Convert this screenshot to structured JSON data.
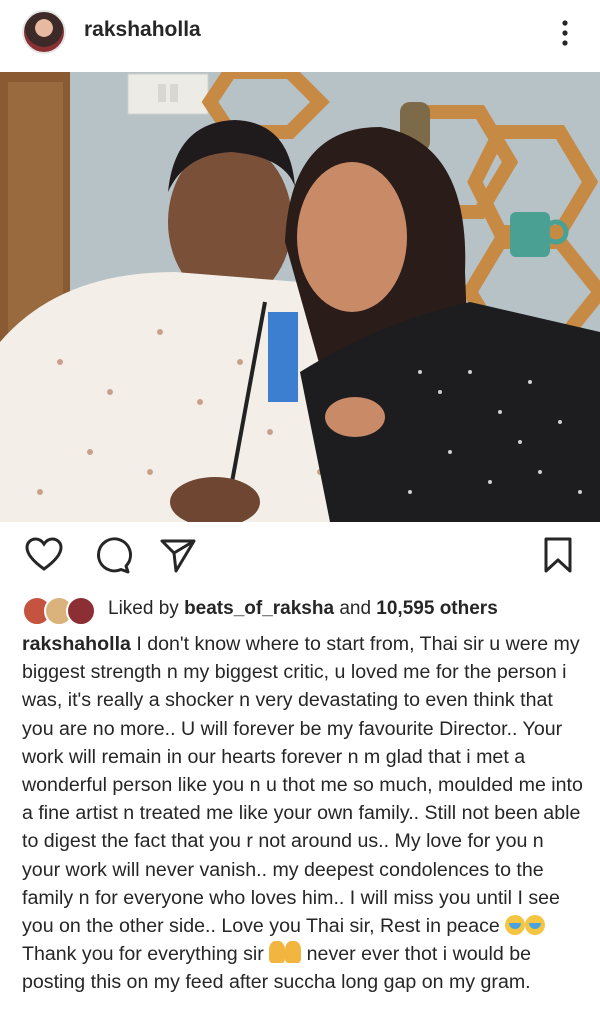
{
  "header": {
    "username": "rakshaholla",
    "more_icon": "more-vertical-icon"
  },
  "post": {
    "photo_description_icon": "photo",
    "actions": {
      "like_icon": "heart-icon",
      "comment_icon": "comment-icon",
      "share_icon": "send-icon",
      "save_icon": "bookmark-icon"
    },
    "likes": {
      "prefix": "Liked by",
      "liker": "beats_of_raksha",
      "and": "and",
      "count": "10,595 others"
    },
    "caption": {
      "user": "rakshaholla",
      "text_1": " I don't know where to start from, Thai sir u were my biggest strength n my biggest critic, u loved me for the person i was, it's really a shocker n very devastating to even think that you are no more.. U will forever be my favourite Director.. Your work will remain in our hearts forever n m glad that i met a wonderful person like you n u thot me so much, moulded me into a fine artist n treated me like your own family.. Still not been able to digest the fact that you r not around us.. My love for you n your work will never vanish.. my deepest condolences to the family n for everyone who loves him.. I will miss you until I see you on the other side.. Love you Thai sir, Rest in peace ",
      "text_2": " Thank you for everything sir ",
      "text_3": " never ever thot i would be posting this on my feed after succha long gap on my gram."
    }
  },
  "colors": {
    "text": "#262626",
    "background": "#ffffff"
  }
}
